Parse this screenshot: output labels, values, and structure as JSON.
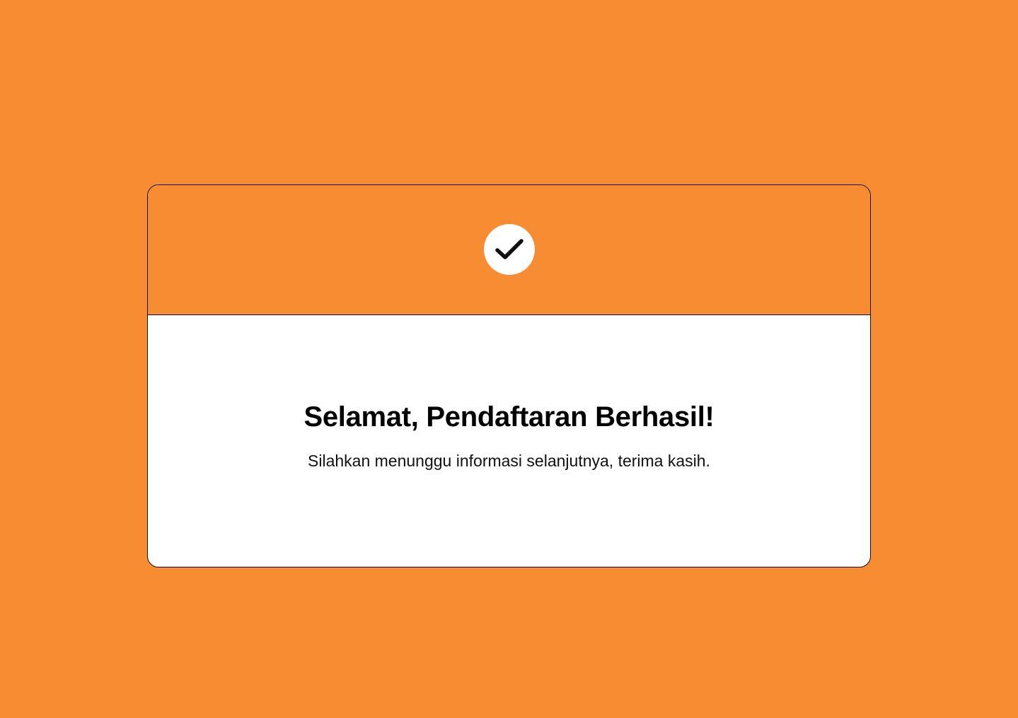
{
  "colors": {
    "background": "#F78C33",
    "card_header": "#F78C33",
    "card_body": "#FFFFFF",
    "border": "#111111",
    "text": "#000000"
  },
  "success_card": {
    "icon": "check-icon",
    "title": "Selamat, Pendaftaran Berhasil!",
    "message": "Silahkan menunggu informasi selanjutnya, terima kasih."
  }
}
